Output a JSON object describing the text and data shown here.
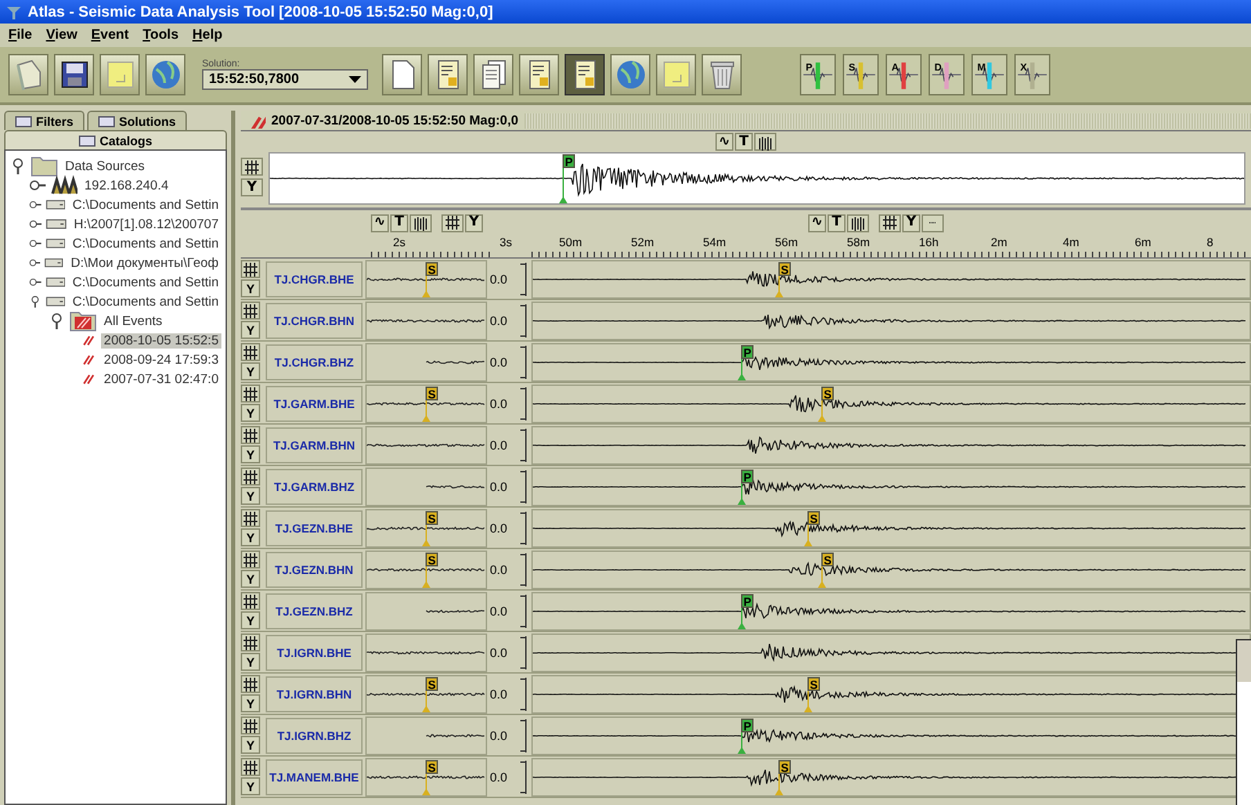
{
  "window": {
    "title": "Atlas - Seismic Data Analysis Tool [2008-10-05 15:52:50 Mag:0,0]"
  },
  "menu": [
    "File",
    "View",
    "Event",
    "Tools",
    "Help"
  ],
  "toolbar": {
    "left_buttons": [
      {
        "kind": "folder",
        "pressed": false
      },
      {
        "kind": "save",
        "pressed": false
      },
      {
        "kind": "note",
        "pressed": false
      },
      {
        "kind": "globe",
        "pressed": false
      }
    ],
    "solution": {
      "label": "Solution:",
      "value": "15:52:50,7800"
    },
    "doc_buttons": [
      {
        "kind": "page",
        "pressed": false
      },
      {
        "kind": "report",
        "pressed": false
      },
      {
        "kind": "pages",
        "pressed": false
      },
      {
        "kind": "report",
        "pressed": false
      },
      {
        "kind": "report",
        "pressed": true
      },
      {
        "kind": "globe",
        "pressed": false
      },
      {
        "kind": "note",
        "pressed": false
      },
      {
        "kind": "trash",
        "pressed": false
      }
    ],
    "phase_buttons": [
      {
        "letter": "P",
        "color": "#30c040"
      },
      {
        "letter": "S",
        "color": "#d8c030"
      },
      {
        "letter": "A",
        "color": "#e04040"
      },
      {
        "letter": "D",
        "color": "#e0a0c0"
      },
      {
        "letter": "M",
        "color": "#30c8e0"
      },
      {
        "letter": "X",
        "color": "#b0b090"
      }
    ]
  },
  "tabs": [
    {
      "label": "Filters",
      "selected": false
    },
    {
      "label": "Solutions",
      "selected": false
    },
    {
      "label": "Catalogs",
      "selected": true
    }
  ],
  "tree": {
    "label": "Data Sources",
    "kind": "folder",
    "expanded": true,
    "selected": false,
    "children": [
      {
        "label": "192.168.240.4",
        "kind": "network",
        "expanded": false,
        "selected": false
      },
      {
        "label": "C:\\Documents and Settin",
        "kind": "drive",
        "expanded": false,
        "selected": false
      },
      {
        "label": "H:\\2007[1].08.12\\200707",
        "kind": "drive",
        "expanded": false,
        "selected": false
      },
      {
        "label": "C:\\Documents and Settin",
        "kind": "drive",
        "expanded": false,
        "selected": false
      },
      {
        "label": "D:\\Мои документы\\Геоф",
        "kind": "drive",
        "expanded": false,
        "selected": false
      },
      {
        "label": "C:\\Documents and Settin",
        "kind": "drive",
        "expanded": false,
        "selected": false
      },
      {
        "label": "C:\\Documents and Settin",
        "kind": "drive",
        "expanded": true,
        "selected": false,
        "children": [
          {
            "label": "All Events",
            "kind": "events",
            "expanded": true,
            "selected": false,
            "children": [
              {
                "label": "2008-10-05 15:52:5",
                "kind": "event",
                "selected": true
              },
              {
                "label": "2008-09-24 17:59:3",
                "kind": "event",
                "selected": false
              },
              {
                "label": "2007-07-31 02:47:0",
                "kind": "event",
                "selected": false
              }
            ]
          }
        ]
      }
    ]
  },
  "event_view": {
    "title": "2007-07-31/2008-10-05 15:52:50 Mag:0,0",
    "overview_controls": [
      {
        "kind": "glyph",
        "label": "∿"
      },
      {
        "kind": "glyph",
        "label": "T"
      },
      {
        "kind": "bars"
      }
    ],
    "overview_side": [
      {
        "kind": "grid"
      },
      {
        "kind": "glyph",
        "label": "Y"
      }
    ],
    "overview_pick": "P",
    "preview_controls": [
      {
        "kind": "glyph",
        "label": "∿"
      },
      {
        "kind": "glyph",
        "label": "T"
      },
      {
        "kind": "bars"
      },
      {
        "kind": "grid"
      },
      {
        "kind": "glyph",
        "label": "Y"
      }
    ],
    "trace_controls": [
      {
        "kind": "glyph",
        "label": "∿"
      },
      {
        "kind": "glyph",
        "label": "T"
      },
      {
        "kind": "bars"
      },
      {
        "kind": "grid"
      },
      {
        "kind": "glyph",
        "label": "Y"
      },
      {
        "kind": "dashes"
      }
    ],
    "preview_ticks": [
      "2s",
      "3s"
    ],
    "trace_ticks": [
      "50m",
      "52m",
      "54m",
      "56m",
      "58m",
      "16h",
      "2m",
      "4m",
      "6m",
      "8"
    ],
    "channels": [
      {
        "name": "TJ.CHGR.BHE",
        "scale": "Y",
        "amp": "0.0",
        "preview_pick": "S",
        "trace_pick": "S"
      },
      {
        "name": "TJ.CHGR.BHN",
        "scale": "Y",
        "amp": "0.0"
      },
      {
        "name": "TJ.CHGR.BHZ",
        "scale": "Y",
        "amp": "0.0",
        "trace_pick": "P"
      },
      {
        "name": "TJ.GARM.BHE",
        "scale": "Y",
        "amp": "0.0",
        "preview_pick": "S",
        "trace_pick": "S"
      },
      {
        "name": "TJ.GARM.BHN",
        "scale": "Y",
        "amp": "0.0"
      },
      {
        "name": "TJ.GARM.BHZ",
        "scale": "Y",
        "amp": "0.0",
        "trace_pick": "P"
      },
      {
        "name": "TJ.GEZN.BHE",
        "scale": "Y",
        "amp": "0.0",
        "preview_pick": "S",
        "trace_pick": "S"
      },
      {
        "name": "TJ.GEZN.BHN",
        "scale": "Y",
        "amp": "0.0",
        "preview_pick": "S",
        "trace_pick": "S"
      },
      {
        "name": "TJ.GEZN.BHZ",
        "scale": "Y",
        "amp": "0.0",
        "trace_pick": "P"
      },
      {
        "name": "TJ.IGRN.BHE",
        "scale": "Y",
        "amp": "0.0"
      },
      {
        "name": "TJ.IGRN.BHN",
        "scale": "Y",
        "amp": "0.0",
        "preview_pick": "S",
        "trace_pick": "S"
      },
      {
        "name": "TJ.IGRN.BHZ",
        "scale": "Y",
        "amp": "0.0",
        "trace_pick": "P"
      },
      {
        "name": "TJ.MANEM.BHE",
        "scale": "Y",
        "amp": "0.0",
        "preview_pick": "S",
        "trace_pick": "S"
      }
    ]
  },
  "overlapping_window": {
    "shown": true
  }
}
